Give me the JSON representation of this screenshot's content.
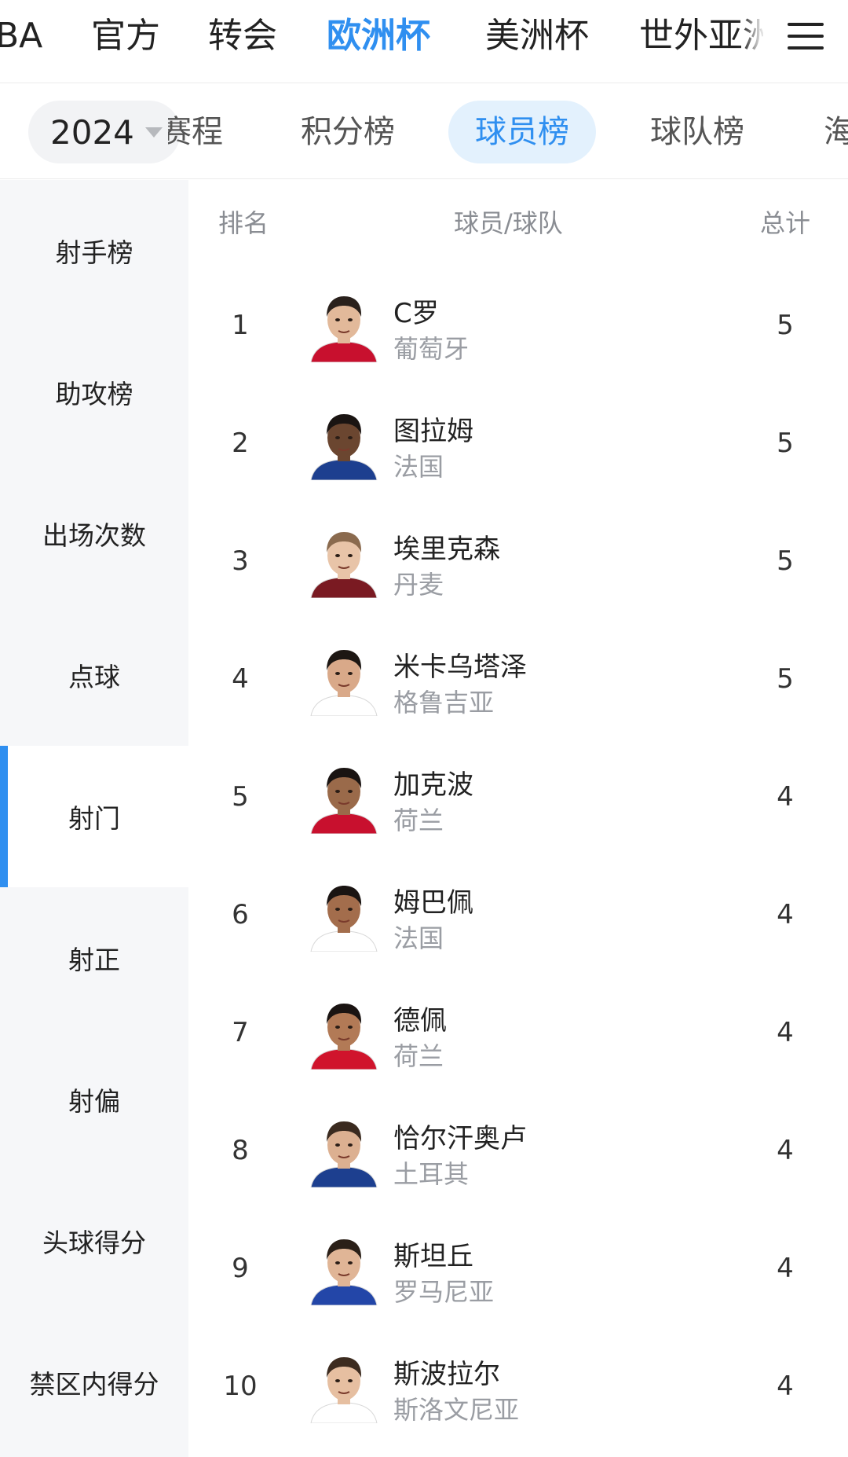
{
  "top_nav": {
    "tabs": [
      {
        "label": "BA",
        "active": false
      },
      {
        "label": "官方",
        "active": false
      },
      {
        "label": "转会",
        "active": false
      },
      {
        "label": "欧洲杯",
        "active": true
      },
      {
        "label": "美洲杯",
        "active": false
      },
      {
        "label": "世外亚洲",
        "active": false
      }
    ],
    "menu_icon": "hamburger-menu-icon"
  },
  "sub_nav": {
    "year": "2024",
    "tabs": [
      {
        "label": "赛程",
        "active": false
      },
      {
        "label": "积分榜",
        "active": false
      },
      {
        "label": "球员榜",
        "active": true
      },
      {
        "label": "球队榜",
        "active": false
      },
      {
        "label": "海",
        "active": false
      }
    ]
  },
  "sidebar": {
    "items": [
      {
        "label": "射手榜",
        "active": false
      },
      {
        "label": "助攻榜",
        "active": false
      },
      {
        "label": "出场次数",
        "active": false
      },
      {
        "label": "点球",
        "active": false
      },
      {
        "label": "射门",
        "active": true
      },
      {
        "label": "射正",
        "active": false
      },
      {
        "label": "射偏",
        "active": false
      },
      {
        "label": "头球得分",
        "active": false
      },
      {
        "label": "禁区内得分",
        "active": false
      }
    ]
  },
  "table": {
    "headers": {
      "rank": "排名",
      "player": "球员/球队",
      "total": "总计"
    },
    "rows": [
      {
        "rank": "1",
        "name": "C罗",
        "team": "葡萄牙",
        "total": "5",
        "jersey": "#c8102e"
      },
      {
        "rank": "2",
        "name": "图拉姆",
        "team": "法国",
        "total": "5",
        "jersey": "#1d3f8f"
      },
      {
        "rank": "3",
        "name": "埃里克森",
        "team": "丹麦",
        "total": "5",
        "jersey": "#7a1a22"
      },
      {
        "rank": "4",
        "name": "米卡乌塔泽",
        "team": "格鲁吉亚",
        "total": "5",
        "jersey": "#ffffff"
      },
      {
        "rank": "5",
        "name": "加克波",
        "team": "荷兰",
        "total": "4",
        "jersey": "#c8102e"
      },
      {
        "rank": "6",
        "name": "姆巴佩",
        "team": "法国",
        "total": "4",
        "jersey": "#ffffff"
      },
      {
        "rank": "7",
        "name": "德佩",
        "team": "荷兰",
        "total": "4",
        "jersey": "#d0142c"
      },
      {
        "rank": "8",
        "name": "恰尔汗奥卢",
        "team": "土耳其",
        "total": "4",
        "jersey": "#1d3f8f"
      },
      {
        "rank": "9",
        "name": "斯坦丘",
        "team": "罗马尼亚",
        "total": "4",
        "jersey": "#2346a8"
      },
      {
        "rank": "10",
        "name": "斯波拉尔",
        "team": "斯洛文尼亚",
        "total": "4",
        "jersey": "#ffffff"
      }
    ]
  }
}
